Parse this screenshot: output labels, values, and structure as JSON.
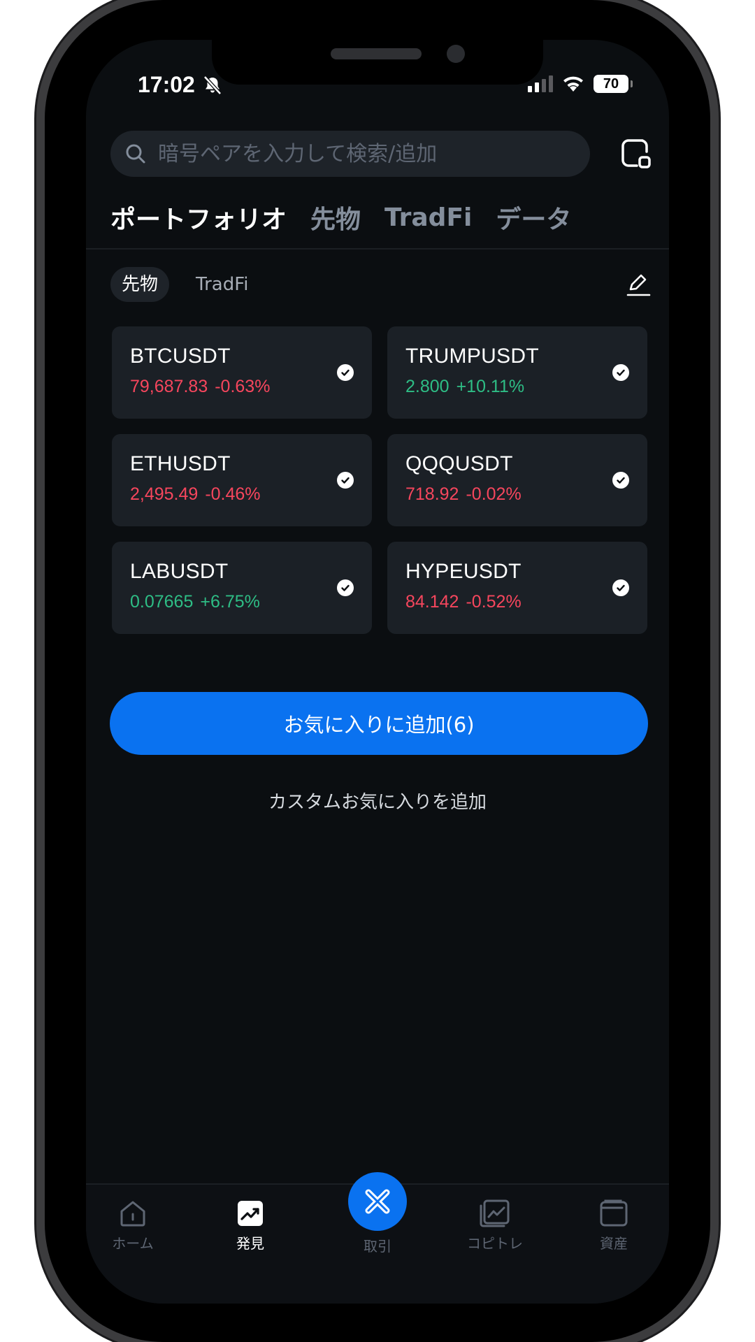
{
  "status_bar": {
    "time": "17:02",
    "battery": "70"
  },
  "search": {
    "placeholder": "暗号ペアを入力して検索/追加"
  },
  "top_tabs": [
    {
      "label": "ポートフォリオ",
      "active": true
    },
    {
      "label": "先物",
      "active": false
    },
    {
      "label": "TradFi",
      "active": false
    },
    {
      "label": "データ",
      "active": false
    }
  ],
  "sub_tabs": [
    {
      "label": "先物",
      "active": true
    },
    {
      "label": "TradFi",
      "active": false
    }
  ],
  "pairs": [
    {
      "symbol": "BTCUSDT",
      "price": "79,687.83",
      "change": "-0.63%",
      "direction": "down",
      "selected": true
    },
    {
      "symbol": "TRUMPUSDT",
      "price": "2.800",
      "change": "+10.11%",
      "direction": "up",
      "selected": true
    },
    {
      "symbol": "ETHUSDT",
      "price": "2,495.49",
      "change": "-0.46%",
      "direction": "down",
      "selected": true
    },
    {
      "symbol": "QQQUSDT",
      "price": "718.92",
      "change": "-0.02%",
      "direction": "down",
      "selected": true
    },
    {
      "symbol": "LABUSDT",
      "price": "0.07665",
      "change": "+6.75%",
      "direction": "up",
      "selected": true
    },
    {
      "symbol": "HYPEUSDT",
      "price": "84.142",
      "change": "-0.52%",
      "direction": "down",
      "selected": true
    }
  ],
  "actions": {
    "add_favorites": "お気に入りに追加(6)",
    "add_custom_favorites": "カスタムお気に入りを追加"
  },
  "bottom_nav": [
    {
      "label": "ホーム",
      "icon": "home-icon",
      "active": false
    },
    {
      "label": "発見",
      "icon": "discover-icon",
      "active": true
    },
    {
      "label": "取引",
      "icon": "trade-icon",
      "active": false
    },
    {
      "label": "コピトレ",
      "icon": "copy-trade-icon",
      "active": false
    },
    {
      "label": "資産",
      "icon": "wallet-icon",
      "active": false
    }
  ],
  "colors": {
    "background": "#0b0e11",
    "card": "#1b2026",
    "accent": "#0a72f0",
    "up": "#2ebd85",
    "down": "#f6465d",
    "muted": "#848e9c"
  }
}
